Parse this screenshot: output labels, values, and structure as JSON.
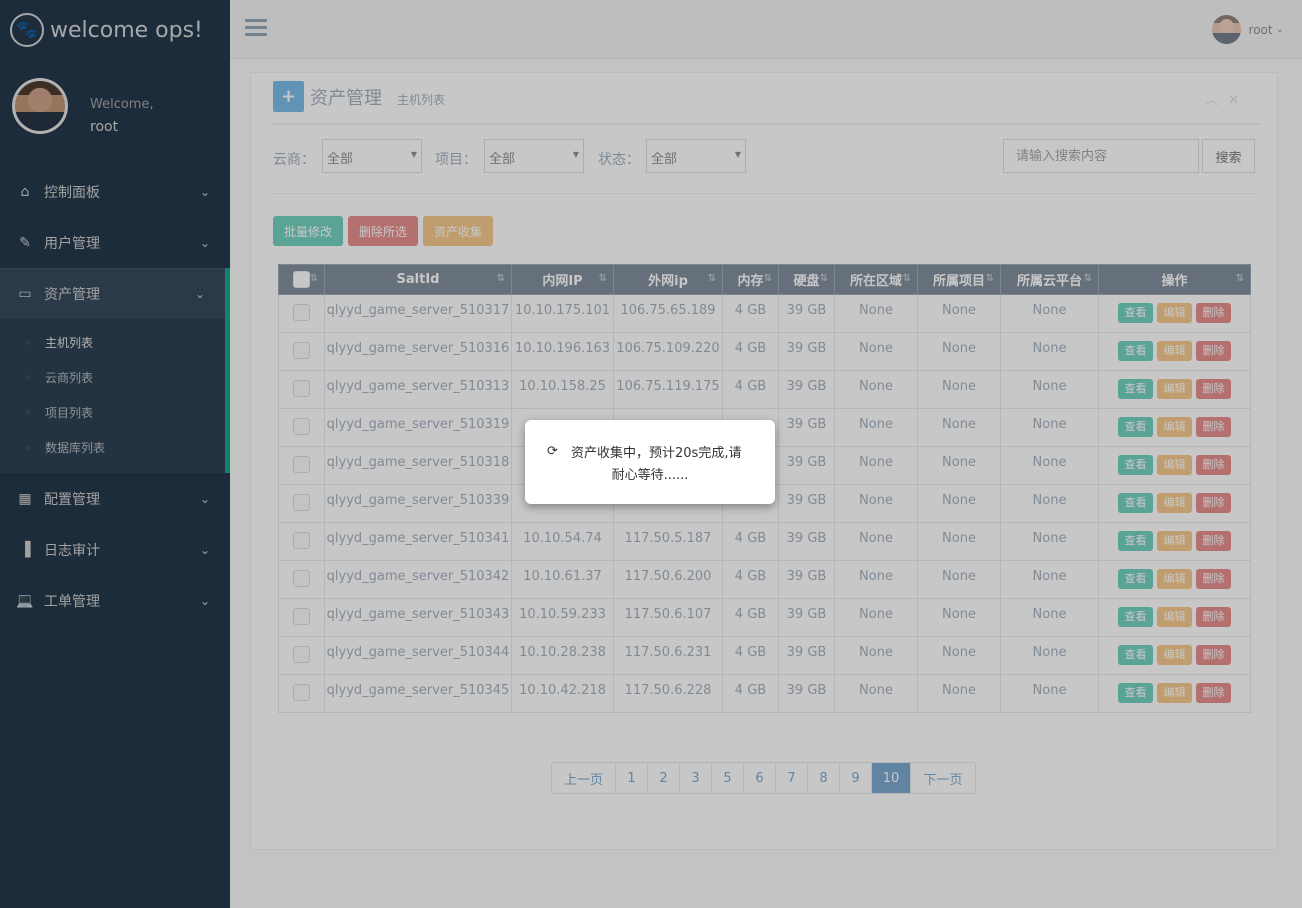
{
  "brand": {
    "title": "welcome ops!"
  },
  "profile": {
    "welcome": "Welcome,",
    "name": "root"
  },
  "sidebar": {
    "items": [
      {
        "label": "控制面板",
        "icon": "home-icon"
      },
      {
        "label": "用户管理",
        "icon": "edit-icon"
      },
      {
        "label": "资产管理",
        "icon": "desktop-icon"
      },
      {
        "label": "配置管理",
        "icon": "table-icon"
      },
      {
        "label": "日志审计",
        "icon": "bar-chart-icon"
      },
      {
        "label": "工单管理",
        "icon": "laptop-icon"
      }
    ],
    "submenu": [
      "主机列表",
      "云商列表",
      "项目列表",
      "数据库列表"
    ]
  },
  "topnav": {
    "user": "root"
  },
  "panel": {
    "title": "资产管理",
    "subtitle": "主机列表"
  },
  "filters": {
    "cloud_label": "云商：",
    "cloud_value": "全部",
    "project_label": "项目：",
    "project_value": "全部",
    "status_label": "状态：",
    "status_value": "全部",
    "search_placeholder": "请输入搜索内容",
    "search_button": "搜索"
  },
  "actions": {
    "batch_edit": "批量修改",
    "delete_selected": "删除所选",
    "asset_collect": "资产收集"
  },
  "table": {
    "headers": [
      "",
      "SaltId",
      "内网IP",
      "外网ip",
      "内存",
      "硬盘",
      "所在区域",
      "所属项目",
      "所属云平台",
      "操作"
    ],
    "op_labels": {
      "view": "查看",
      "edit": "编辑",
      "delete": "删除"
    },
    "rows": [
      [
        "qlyyd_game_server_510317",
        "10.10.175.101",
        "106.75.65.189",
        "4 GB",
        "39 GB",
        "None",
        "None",
        "None"
      ],
      [
        "qlyyd_game_server_510316",
        "10.10.196.163",
        "106.75.109.220",
        "4 GB",
        "39 GB",
        "None",
        "None",
        "None"
      ],
      [
        "qlyyd_game_server_510313",
        "10.10.158.25",
        "106.75.119.175",
        "4 GB",
        "39 GB",
        "None",
        "None",
        "None"
      ],
      [
        "qlyyd_game_server_510319",
        "",
        "",
        "",
        "39 GB",
        "None",
        "None",
        "None"
      ],
      [
        "qlyyd_game_server_510318",
        "",
        "",
        "",
        "39 GB",
        "None",
        "None",
        "None"
      ],
      [
        "qlyyd_game_server_510339",
        "",
        "",
        "",
        "39 GB",
        "None",
        "None",
        "None"
      ],
      [
        "qlyyd_game_server_510341",
        "10.10.54.74",
        "117.50.5.187",
        "4 GB",
        "39 GB",
        "None",
        "None",
        "None"
      ],
      [
        "qlyyd_game_server_510342",
        "10.10.61.37",
        "117.50.6.200",
        "4 GB",
        "39 GB",
        "None",
        "None",
        "None"
      ],
      [
        "qlyyd_game_server_510343",
        "10.10.59.233",
        "117.50.6.107",
        "4 GB",
        "39 GB",
        "None",
        "None",
        "None"
      ],
      [
        "qlyyd_game_server_510344",
        "10.10.28.238",
        "117.50.6.231",
        "4 GB",
        "39 GB",
        "None",
        "None",
        "None"
      ],
      [
        "qlyyd_game_server_510345",
        "10.10.42.218",
        "117.50.6.228",
        "4 GB",
        "39 GB",
        "None",
        "None",
        "None"
      ]
    ]
  },
  "pagination": {
    "prev": "上一页",
    "pages": [
      "1",
      "2",
      "3",
      "5",
      "6",
      "7",
      "8",
      "9",
      "10"
    ],
    "active": "10",
    "next": "下一页"
  },
  "modal": {
    "line1": "资产收集中，预计20s完成,请",
    "line2": "耐心等待......"
  },
  "colors": {
    "sidebar": "#2a3f54",
    "accent": "#1abb9c",
    "primary": "#337ab7",
    "success": "#26b99a",
    "warning": "#f0ad4e",
    "danger": "#d9534f"
  }
}
